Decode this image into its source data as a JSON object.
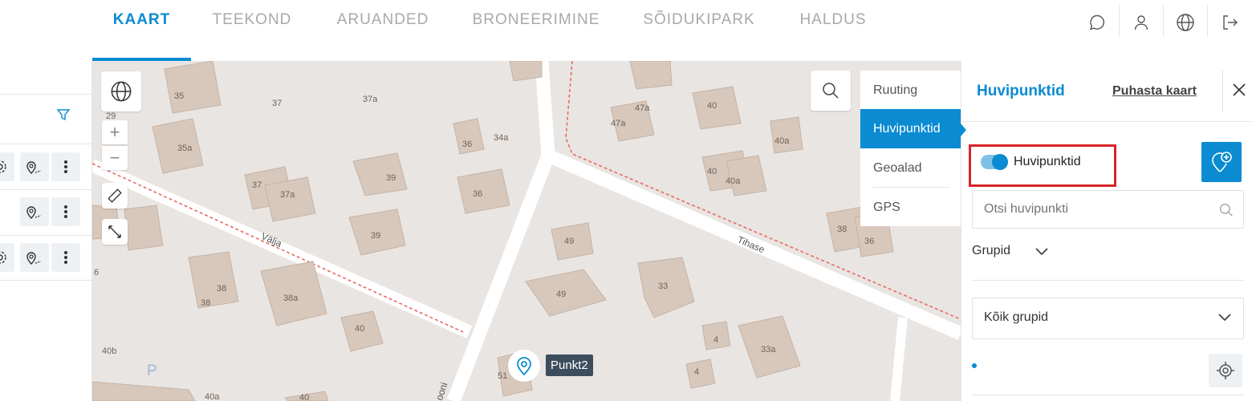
{
  "nav": {
    "tabs": [
      {
        "label": "KAART",
        "active": true
      },
      {
        "label": "TEEKOND",
        "active": false
      },
      {
        "label": "ARUANDED",
        "active": false
      },
      {
        "label": "BRONEERIMINE",
        "active": false
      },
      {
        "label": "SÕIDUKIPARK",
        "active": false
      },
      {
        "label": "HALDUS",
        "active": false
      }
    ],
    "icons": [
      "chat-icon",
      "user-icon",
      "globe-icon",
      "logout-icon"
    ]
  },
  "map": {
    "street_labels": {
      "valja": "Välja",
      "tihase": "Tihase",
      "kooni": "ooni"
    },
    "building_numbers": [
      "35",
      "37",
      "37a",
      "29",
      "35a",
      "36",
      "34a",
      "39",
      "37",
      "37a",
      "36",
      "39",
      "38",
      "38",
      "38a",
      "40",
      "40b",
      "40a",
      "40",
      "49",
      "49",
      "33",
      "4",
      "4",
      "33a",
      "51",
      "47a",
      "40",
      "47a",
      "40",
      "40a",
      "40a",
      "38",
      "36",
      "6"
    ],
    "parking": "P",
    "marker_label": "Punkt2",
    "zoom_in": "+",
    "zoom_out": "−"
  },
  "layer_menu": {
    "items": [
      "Ruuting",
      "Huvipunktid",
      "Geoalad",
      "GPS"
    ],
    "active": "Huvipunktid"
  },
  "panel": {
    "title": "Huvipunktid",
    "clear_link": "Puhasta kaart",
    "toggle_label": "Huvipunktid",
    "toggle_on": true,
    "search_placeholder": "Otsi huvipunkti",
    "groups_label": "Grupid",
    "groups_select": "Kõik grupid"
  },
  "colors": {
    "accent": "#0b8bd1",
    "highlight_border": "#d9232a",
    "map_bg": "#e9e5e2",
    "building": "#d8c8bc",
    "marker_label_bg": "#3d4d5e"
  }
}
